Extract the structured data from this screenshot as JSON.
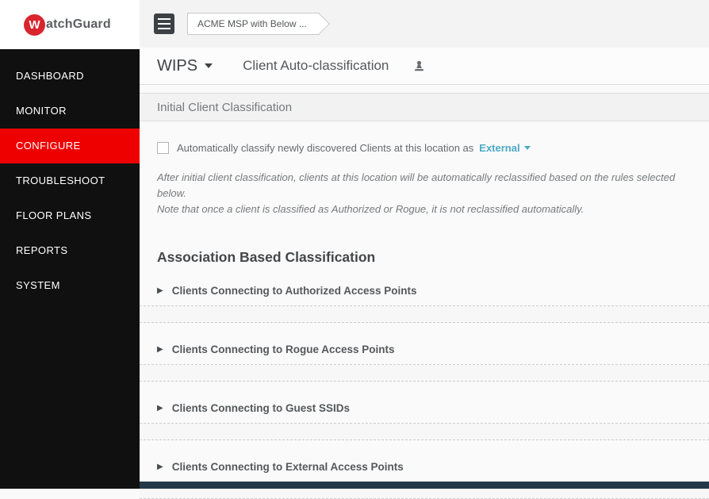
{
  "brand": {
    "initial": "W",
    "rest": "atchGuard"
  },
  "sidebar": {
    "items": [
      {
        "label": "DASHBOARD",
        "active": false
      },
      {
        "label": "MONITOR",
        "active": false
      },
      {
        "label": "CONFIGURE",
        "active": true
      },
      {
        "label": "TROUBLESHOOT",
        "active": false
      },
      {
        "label": "FLOOR PLANS",
        "active": false
      },
      {
        "label": "REPORTS",
        "active": false
      },
      {
        "label": "SYSTEM",
        "active": false
      }
    ]
  },
  "topbar": {
    "breadcrumb": "ACME MSP with Below ..."
  },
  "header": {
    "module": "WIPS",
    "title": "Client Auto-classification"
  },
  "initial_classification": {
    "section_title": "Initial Client Classification",
    "checkbox_label": "Automatically classify newly discovered Clients at this location as",
    "checkbox_checked": false,
    "dropdown_value": "External",
    "note_line1": "After initial client classification, clients at this location will be automatically reclassified based on the rules selected below.",
    "note_line2": "Note that once a client is classified as Authorized or Rogue, it is not reclassified automatically."
  },
  "association_classification": {
    "heading": "Association Based Classification",
    "rules": [
      {
        "label": "Clients Connecting to Authorized Access Points"
      },
      {
        "label": "Clients Connecting to Rogue Access Points"
      },
      {
        "label": "Clients Connecting to Guest SSIDs"
      },
      {
        "label": "Clients Connecting to External Access Points"
      }
    ]
  },
  "icons": {
    "menu": "hamburger-icon",
    "title_badge": "stamp-icon",
    "expand": "triangle-right-icon"
  },
  "colors": {
    "accent_red": "#ee0000",
    "link_teal": "#4aa9c4",
    "footer_navy": "#24384a",
    "sidebar_black": "#101010"
  }
}
